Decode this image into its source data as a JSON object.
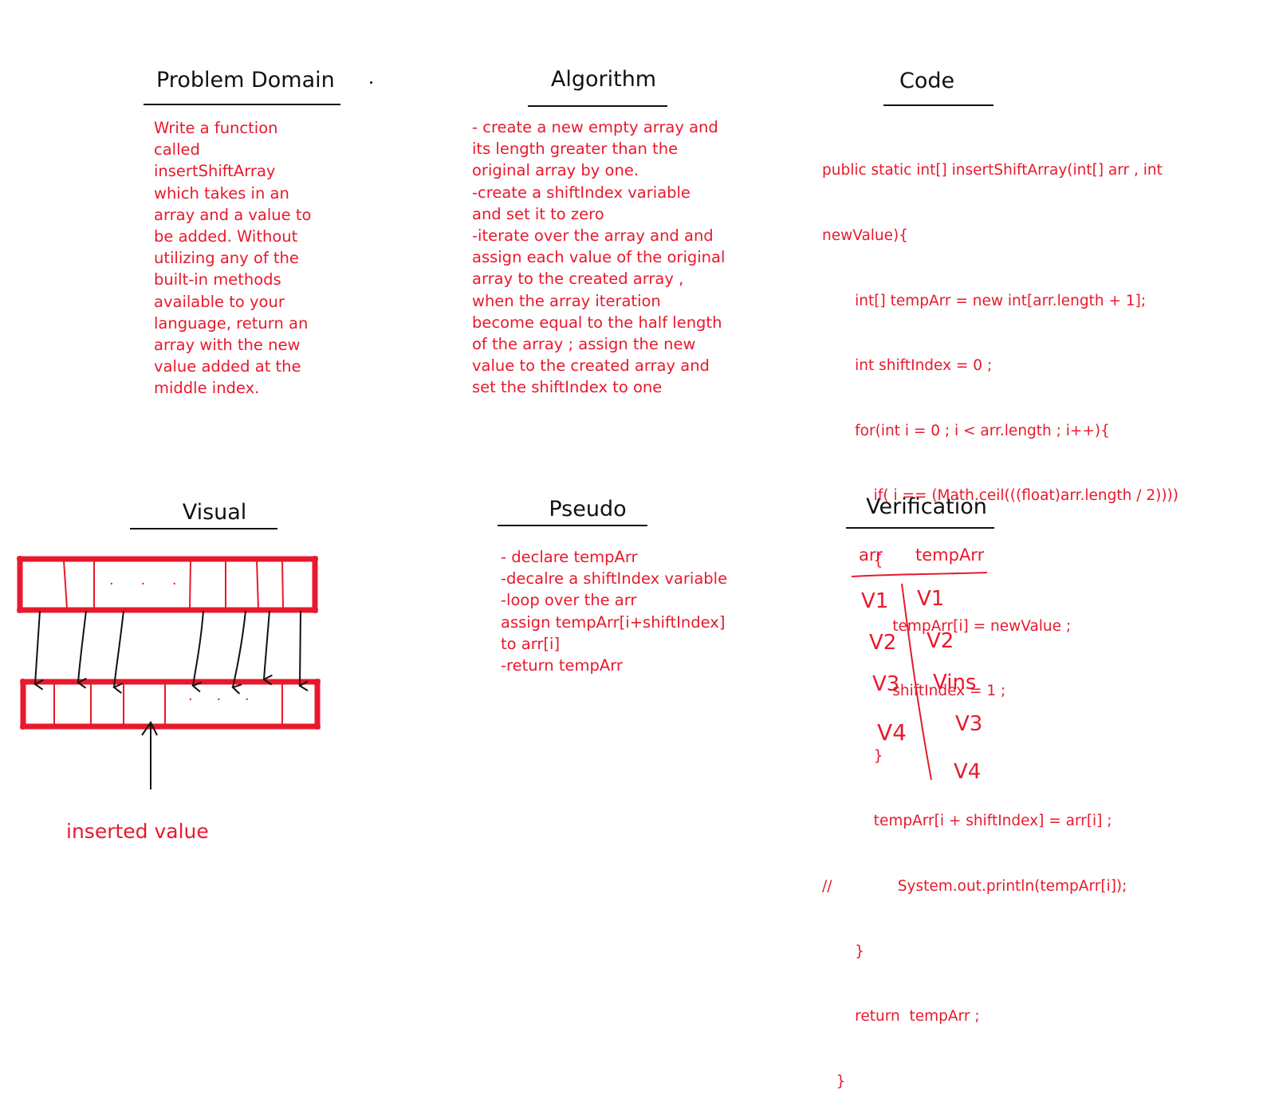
{
  "sections": {
    "problem_domain": {
      "title": "Problem Domain",
      "lines": [
        "Write a function",
        "called",
        "insertShiftArray",
        "which takes in an",
        "array and a value to",
        "be added. Without",
        "utilizing any of the",
        "built-in methods",
        "available to your",
        "language, return an",
        "array with the new",
        "value added at the",
        "middle index."
      ]
    },
    "algorithm": {
      "title": "Algorithm",
      "lines": [
        "- create a new empty array  and",
        "its length greater than the",
        "original array by one.",
        "-create a shiftIndex variable",
        "and set it to zero",
        "-iterate  over the array and and",
        "assign each value of the original",
        "array to the created array  ,",
        "when the array iteration",
        "become equal to the half length",
        "of the array  ; assign the new",
        "value to the created array and",
        "set the shiftIndex to one"
      ]
    },
    "code": {
      "title": "Code",
      "lines": [
        "public static int[] insertShiftArray(int[] arr , int",
        "newValue){",
        "       int[] tempArr = new int[arr.length + 1];",
        "       int shiftIndex = 0 ;",
        "       for(int i = 0 ; i < arr.length ; i++){",
        "           if( i == (Math.ceil(((float)arr.length / 2))))",
        "           {",
        "               tempArr[i] = newValue ;",
        "               shiftIndex = 1 ;",
        "           }",
        "           tempArr[i + shiftIndex] = arr[i] ;",
        "//              System.out.println(tempArr[i]);",
        "       }",
        "       return  tempArr ;",
        "   }"
      ]
    },
    "visual": {
      "title": "Visual",
      "dots_top": ". . .",
      "dots_bottom": ". . .",
      "caption": "inserted value"
    },
    "pseudo": {
      "title": "Pseudo",
      "lines": [
        "- declare tempArr",
        "-decalre a shiftIndex variable",
        "-loop over the arr",
        "assign tempArr[i+shiftIndex]",
        "to arr[i]",
        "-return tempArr"
      ]
    },
    "verification": {
      "title": "Verification",
      "col_left": "arr",
      "col_right": "tempArr",
      "left_values": [
        "V1",
        "V2",
        "V3",
        "V4"
      ],
      "right_values": [
        "V1",
        "V2",
        "Vins",
        "V3",
        "V4"
      ]
    }
  },
  "colors": {
    "ink": "#111111",
    "red": "#e8192c",
    "background": "#ffffff"
  }
}
